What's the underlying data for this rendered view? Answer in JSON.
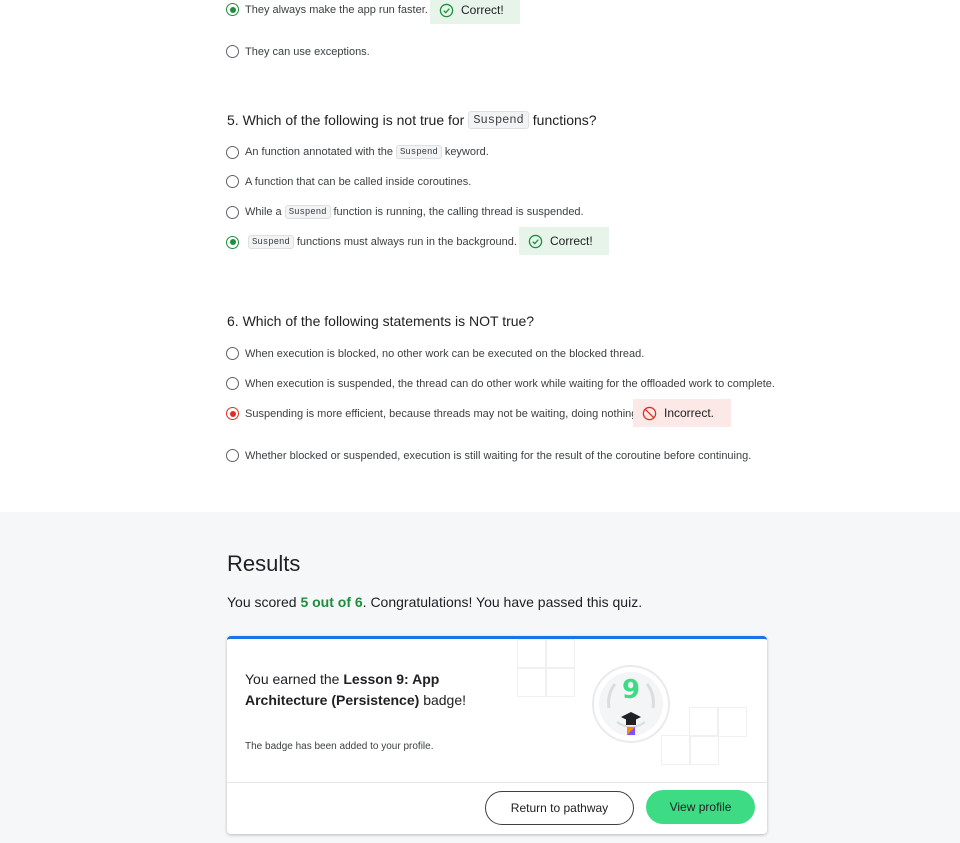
{
  "q4": {
    "options": [
      {
        "text": "They always make the app run faster."
      },
      {
        "text": "They can use exceptions."
      }
    ],
    "feedback": "Correct!"
  },
  "q5": {
    "question_pre": "5. Which of the following is not true for",
    "question_code": "Suspend",
    "question_post": "functions?",
    "options": [
      {
        "pre": "An function annotated with the",
        "code": "Suspend",
        "post": "keyword."
      },
      {
        "text": "A function that can be called inside coroutines."
      },
      {
        "pre": "While a",
        "code": "Suspend",
        "post": "function is running, the calling thread is suspended."
      },
      {
        "code": "Suspend",
        "post": "functions must always run in the background."
      }
    ],
    "feedback": "Correct!"
  },
  "q6": {
    "question": "6. Which of the following statements is NOT true?",
    "options": [
      {
        "text": "When execution is blocked, no other work can be executed on the blocked thread."
      },
      {
        "text": "When execution is suspended, the thread can do other work while waiting for the offloaded work to complete."
      },
      {
        "text": "Suspending is more efficient, because threads may not be waiting, doing nothing."
      },
      {
        "text": "Whether blocked or suspended, execution is still waiting for the result of the coroutine before continuing."
      }
    ],
    "feedback": "Incorrect."
  },
  "results": {
    "title": "Results",
    "score_pre": "You scored",
    "score_value": "5 out of 6",
    "score_post": ". Congratulations! You have passed this quiz.",
    "earned_pre": "You earned the",
    "badge_name": "Lesson 9: App Architecture (Persistence)",
    "earned_post": "badge!",
    "badge_note": "The badge has been added to your profile.",
    "badge_number": "9",
    "return_button": "Return to pathway",
    "profile_button": "View profile"
  },
  "colors": {
    "correct": "#1e8e3e",
    "incorrect": "#d93025",
    "accent_blue": "#1a73e8",
    "android_green": "#3ddc84"
  },
  "icons": [
    "check-circle-icon",
    "blocked-circle-icon",
    "badge-icon"
  ]
}
